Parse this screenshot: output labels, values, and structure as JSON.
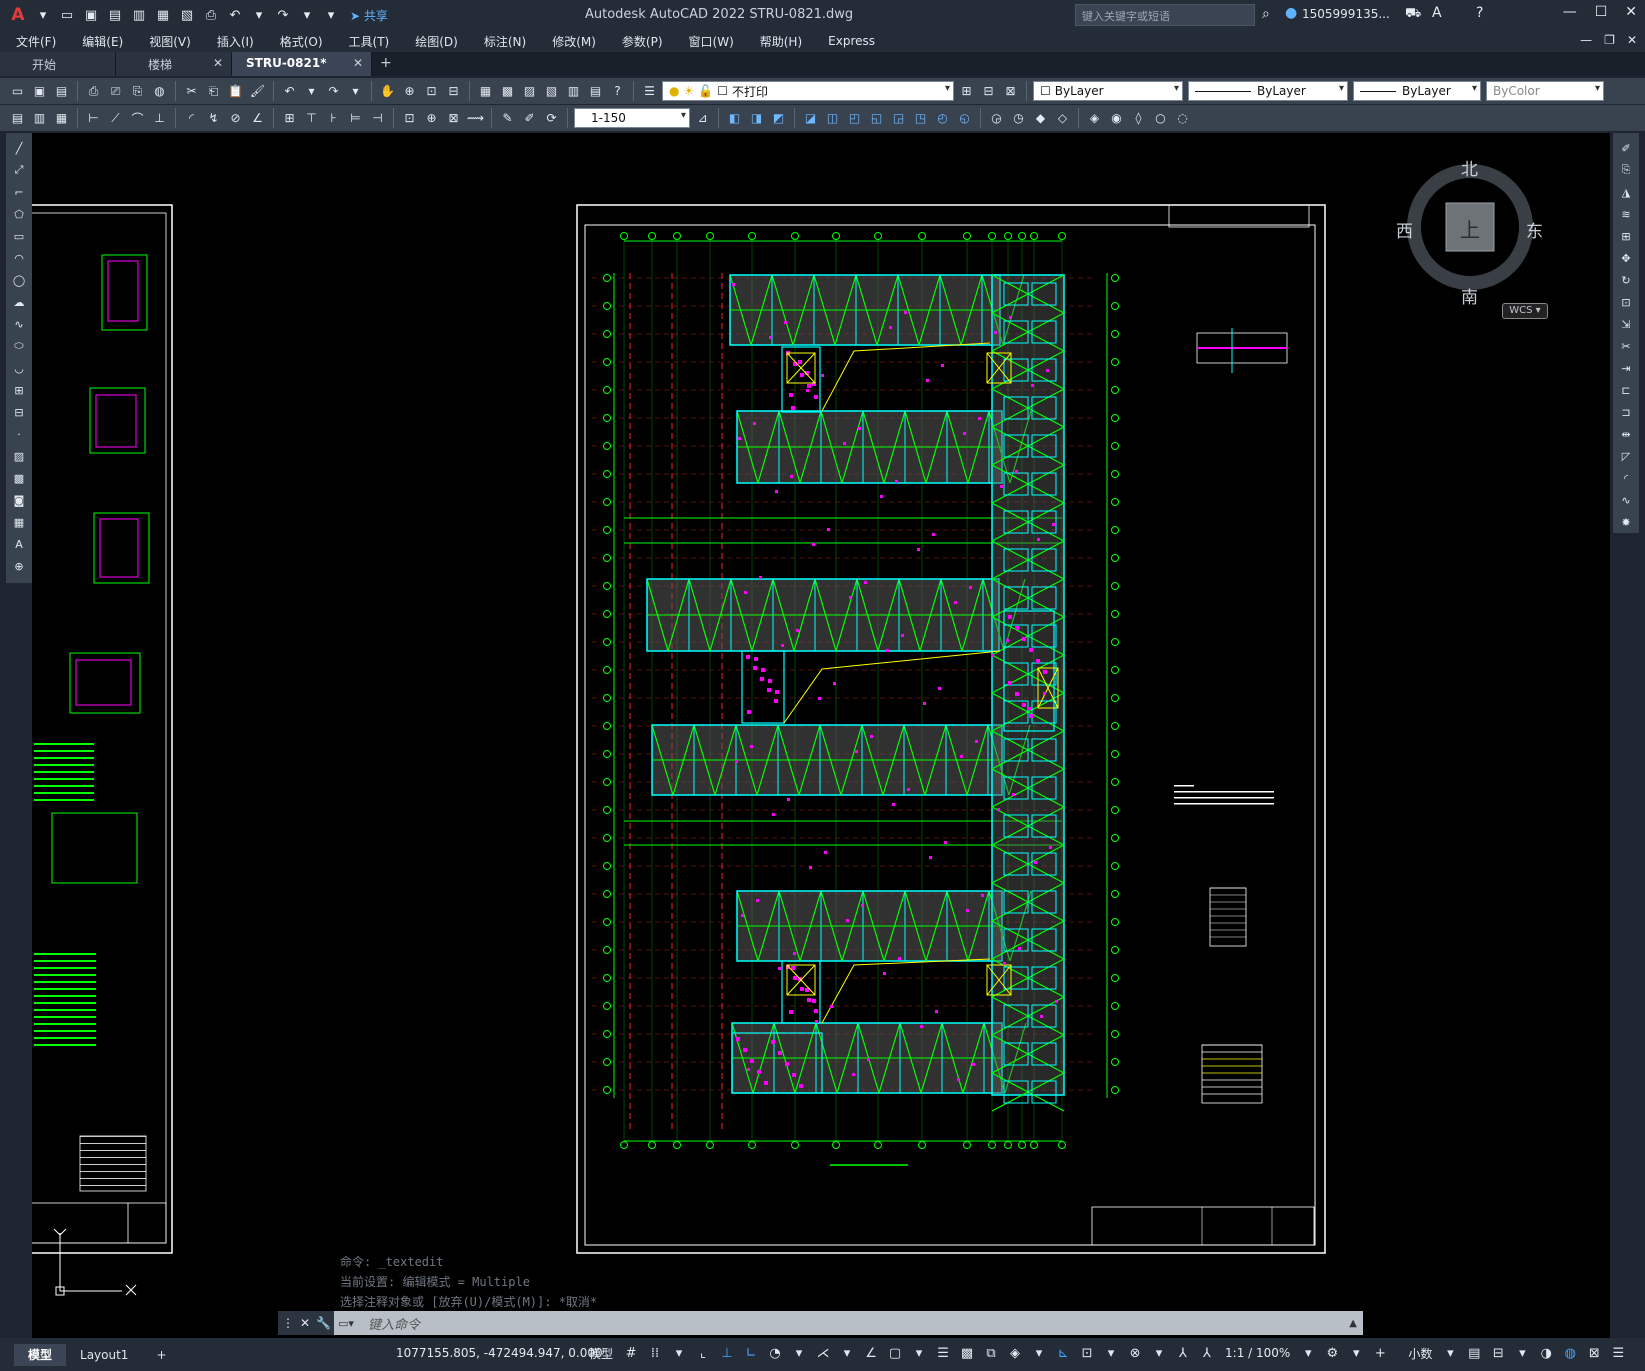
{
  "title_bar": {
    "app_title": "Autodesk AutoCAD 2022    STRU-0821.dwg",
    "share_label": "共享",
    "search_placeholder": "键入关键字或短语",
    "user_name": "1505999135...",
    "logo_text": "A"
  },
  "menu": [
    "文件(F)",
    "编辑(E)",
    "视图(V)",
    "插入(I)",
    "格式(O)",
    "工具(T)",
    "绘图(D)",
    "标注(N)",
    "修改(M)",
    "参数(P)",
    "窗口(W)",
    "帮助(H)",
    "Express"
  ],
  "tabs": [
    {
      "label": "开始",
      "active": false
    },
    {
      "label": "楼梯",
      "active": false
    },
    {
      "label": "STRU-0821*",
      "active": true
    }
  ],
  "toolbar": {
    "layer_name": "不打印",
    "color": "ByLayer",
    "linetype": "ByLayer",
    "lineweight": "ByLayer",
    "plotstyle": "ByColor",
    "scale": "1-150"
  },
  "viewcube": {
    "north": "北",
    "south": "南",
    "east": "东",
    "west": "西",
    "top": "上",
    "wcs": "WCS"
  },
  "command_history": [
    "命令: _textedit",
    "当前设置: 编辑模式 = Multiple",
    "选择注释对象或 [放弃(U)/模式(M)]: *取消*"
  ],
  "command_placeholder": "键入命令",
  "status": {
    "model_tab": "模型",
    "layout_tab": "Layout1",
    "coordinates": "1077155.805, -472494.947, 0.000",
    "model_label": "模型",
    "annotation_scale": "1:1 / 100%",
    "units": "小数"
  },
  "colors": {
    "cad_green": "#00ff00",
    "cad_cyan": "#00ffff",
    "cad_magenta": "#ff00ff",
    "cad_red": "#ff2020",
    "cad_yellow": "#ffff00",
    "ui_dark": "#242c38",
    "ui_toolbar": "#39424f",
    "accent_blue": "#49a4ff"
  }
}
